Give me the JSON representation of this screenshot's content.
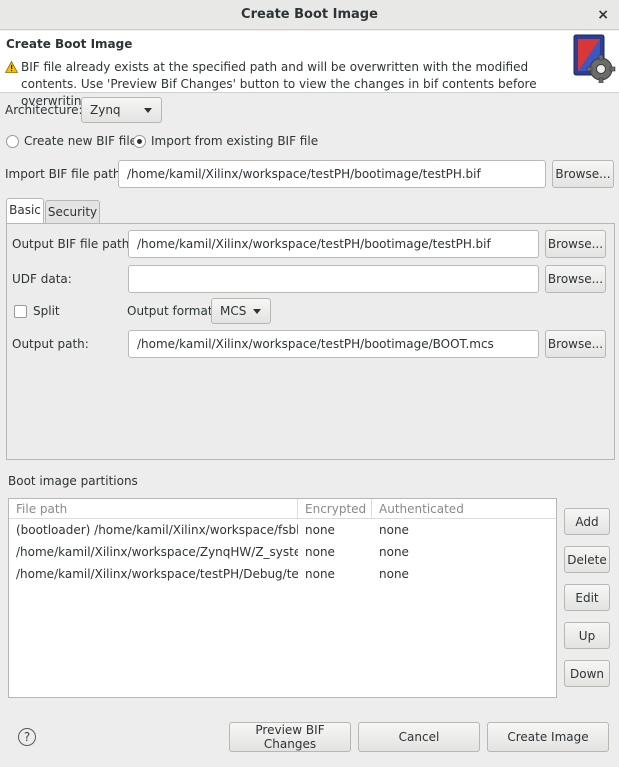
{
  "window": {
    "title": "Create Boot Image",
    "close_glyph": "×"
  },
  "header": {
    "title": "Create Boot Image",
    "message": "BIF file already exists at the specified path and will be overwritten with the modified contents. Use 'Preview Bif Changes' button to view the changes in bif contents before overwriting.",
    "warning_icon": "warning-icon",
    "logo_icon": "boot-image-gear-icon"
  },
  "architecture": {
    "label": "Architecture:",
    "value": "Zynq"
  },
  "bif_mode": {
    "options": [
      {
        "label": "Create new BIF file",
        "selected": false
      },
      {
        "label": "Import from existing BIF file",
        "selected": true
      }
    ]
  },
  "import_path": {
    "label": "Import BIF file path:",
    "value": "/home/kamil/Xilinx/workspace/testPH/bootimage/testPH.bif",
    "browse": "Browse..."
  },
  "tabs": [
    {
      "label": "Basic",
      "active": true
    },
    {
      "label": "Security",
      "active": false
    }
  ],
  "basic": {
    "output_bif": {
      "label": "Output BIF file path:",
      "value": "/home/kamil/Xilinx/workspace/testPH/bootimage/testPH.bif",
      "browse": "Browse..."
    },
    "udf": {
      "label": "UDF data:",
      "value": "",
      "browse": "Browse..."
    },
    "split": {
      "label": "Split",
      "checked": false
    },
    "output_format": {
      "label": "Output format:",
      "value": "MCS"
    },
    "output_path": {
      "label": "Output path:",
      "value": "/home/kamil/Xilinx/workspace/testPH/bootimage/BOOT.mcs",
      "browse": "Browse..."
    }
  },
  "partitions": {
    "label": "Boot image partitions",
    "columns": [
      "File path",
      "Encrypted",
      "Authenticated"
    ],
    "rows": [
      [
        "(bootloader) /home/kamil/Xilinx/workspace/fsbl/Relea",
        "none",
        "none"
      ],
      [
        "/home/kamil/Xilinx/workspace/ZynqHW/Z_system_wr",
        "none",
        "none"
      ],
      [
        "/home/kamil/Xilinx/workspace/testPH/Debug/testPH.",
        "none",
        "none"
      ]
    ],
    "buttons": {
      "add": "Add",
      "delete": "Delete",
      "edit": "Edit",
      "up": "Up",
      "down": "Down"
    }
  },
  "footer": {
    "help": "?",
    "preview": "Preview BIF Changes",
    "cancel": "Cancel",
    "create": "Create Image"
  }
}
